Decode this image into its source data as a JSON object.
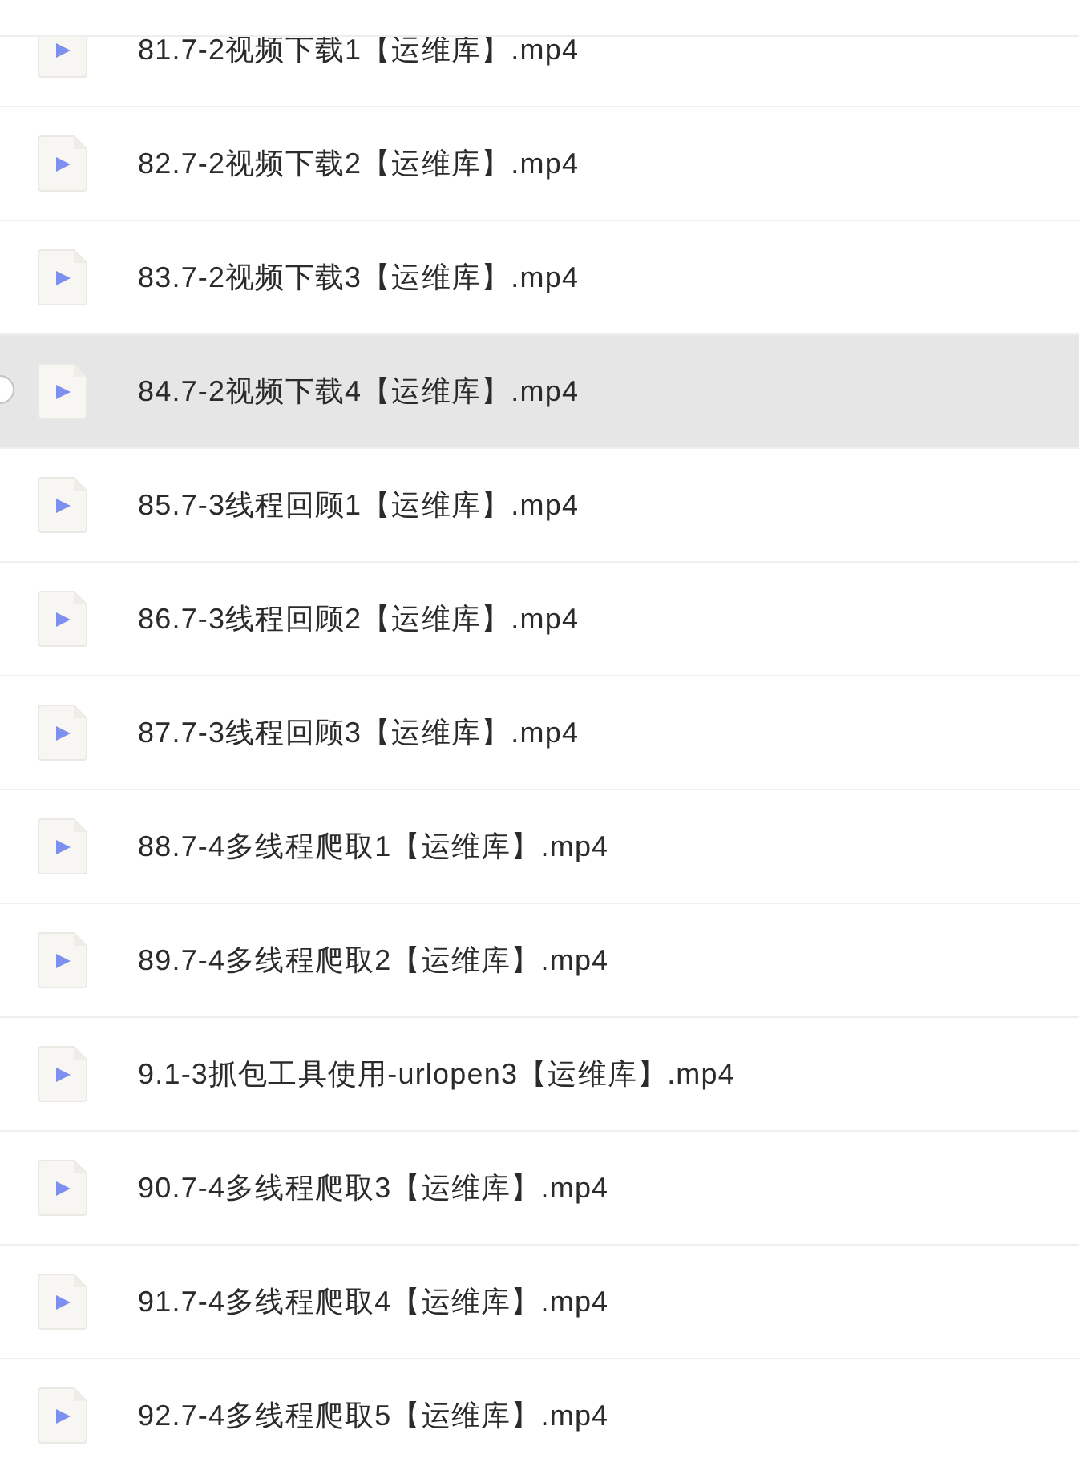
{
  "files": [
    {
      "name": "81.7-2视频下载1【运维库】.mp4",
      "selected": false
    },
    {
      "name": "82.7-2视频下载2【运维库】.mp4",
      "selected": false
    },
    {
      "name": "83.7-2视频下载3【运维库】.mp4",
      "selected": false
    },
    {
      "name": "84.7-2视频下载4【运维库】.mp4",
      "selected": true
    },
    {
      "name": "85.7-3线程回顾1【运维库】.mp4",
      "selected": false
    },
    {
      "name": "86.7-3线程回顾2【运维库】.mp4",
      "selected": false
    },
    {
      "name": "87.7-3线程回顾3【运维库】.mp4",
      "selected": false
    },
    {
      "name": "88.7-4多线程爬取1【运维库】.mp4",
      "selected": false
    },
    {
      "name": "89.7-4多线程爬取2【运维库】.mp4",
      "selected": false
    },
    {
      "name": "9.1-3抓包工具使用-urlopen3【运维库】.mp4",
      "selected": false
    },
    {
      "name": "90.7-4多线程爬取3【运维库】.mp4",
      "selected": false
    },
    {
      "name": "91.7-4多线程爬取4【运维库】.mp4",
      "selected": false
    },
    {
      "name": "92.7-4多线程爬取5【运维库】.mp4",
      "selected": false
    }
  ]
}
